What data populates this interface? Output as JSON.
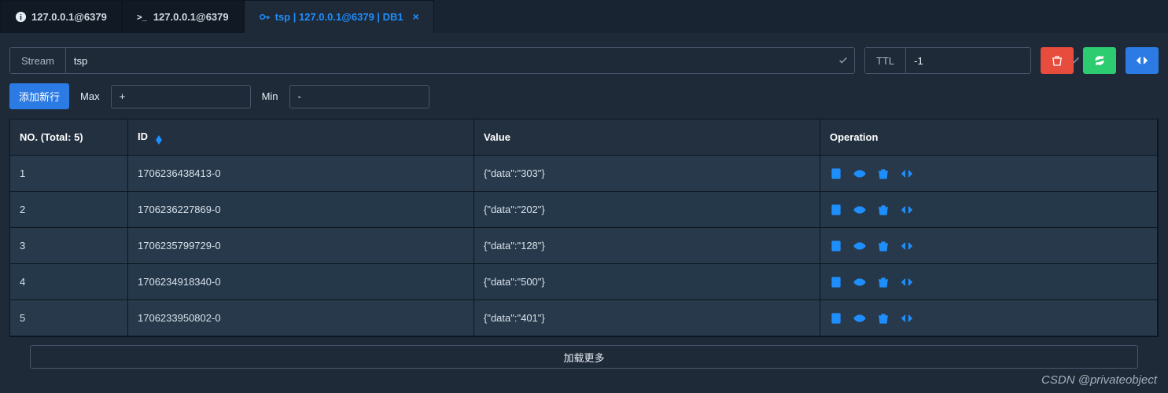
{
  "tabs": [
    {
      "icon": "info",
      "label": "127.0.0.1@6379",
      "active": false,
      "closable": false
    },
    {
      "icon": "term",
      "label": "127.0.0.1@6379",
      "active": false,
      "closable": false
    },
    {
      "icon": "key",
      "label": "tsp | 127.0.0.1@6379 | DB1",
      "active": true,
      "closable": true
    }
  ],
  "key": {
    "type_label": "Stream",
    "name": "tsp"
  },
  "ttl": {
    "label": "TTL",
    "value": "-1"
  },
  "controls": {
    "add_row": "添加新行",
    "max_label": "Max",
    "max_value": "+",
    "min_label": "Min",
    "min_value": "-"
  },
  "table": {
    "total_label": "NO. (Total: 5)",
    "columns": {
      "id": "ID",
      "value": "Value",
      "op": "Operation"
    },
    "rows": [
      {
        "no": "1",
        "id": "1706236438413-0",
        "value": "{\"data\":\"303\"}"
      },
      {
        "no": "2",
        "id": "1706236227869-0",
        "value": "{\"data\":\"202\"}"
      },
      {
        "no": "3",
        "id": "1706235799729-0",
        "value": "{\"data\":\"128\"}"
      },
      {
        "no": "4",
        "id": "1706234918340-0",
        "value": "{\"data\":\"500\"}"
      },
      {
        "no": "5",
        "id": "1706233950802-0",
        "value": "{\"data\":\"401\"}"
      }
    ]
  },
  "load_more": "加载更多",
  "watermark": "CSDN @privateobject"
}
